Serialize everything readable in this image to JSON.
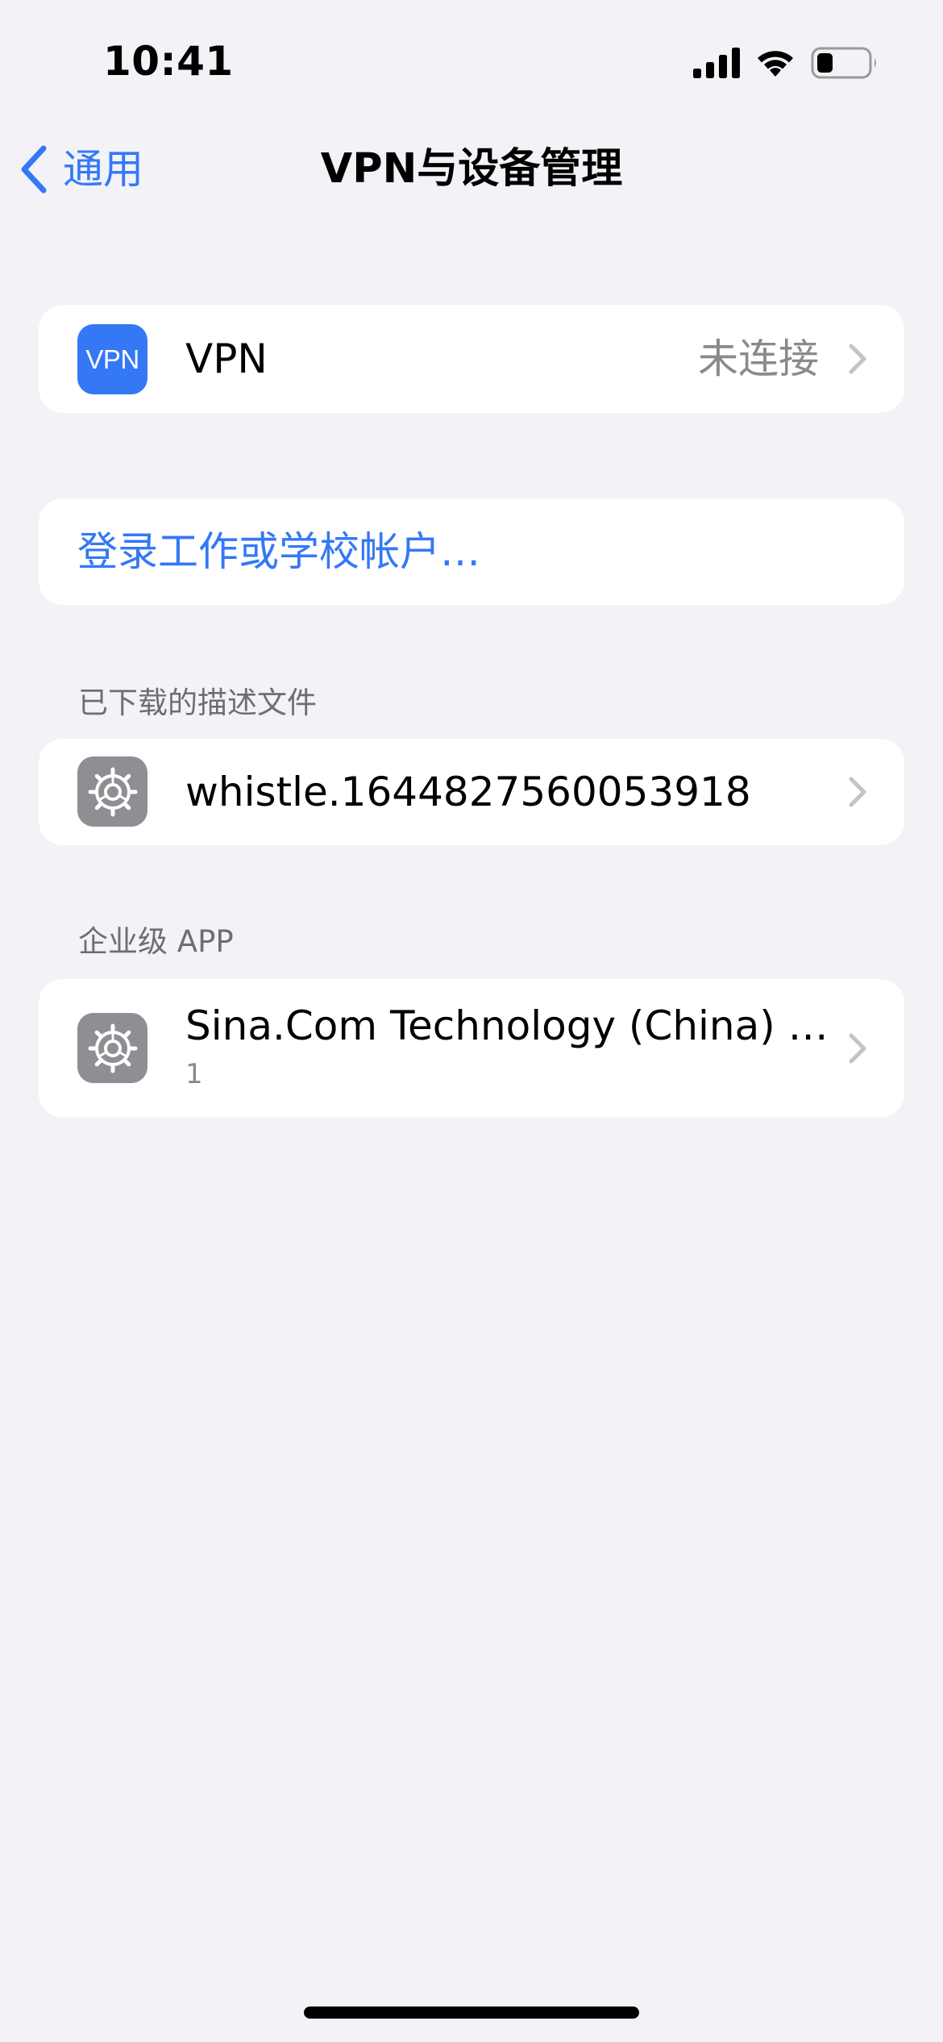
{
  "status_bar": {
    "time": "10:41"
  },
  "nav": {
    "back_label": "通用",
    "title": "VPN与设备管理"
  },
  "vpn_row": {
    "icon_text": "VPN",
    "label": "VPN",
    "value": "未连接"
  },
  "account_row": {
    "label": "登录工作或学校帐户…"
  },
  "profiles_section": {
    "header": "已下载的描述文件",
    "items": [
      {
        "label": "whistle.1644827560053918"
      }
    ]
  },
  "enterprise_section": {
    "header": "企业级 APP",
    "items": [
      {
        "label": "Sina.Com Technology (China) Co...",
        "sublabel": "1"
      }
    ]
  },
  "colors": {
    "background": "#F2F2F7",
    "card": "#FFFFFF",
    "accent": "#3478F6",
    "secondary_text": "#8A8A8E",
    "gear_tile": "#8E8E93",
    "chevron": "#C4C4C7"
  },
  "icons": [
    "signal-icon",
    "wifi-icon",
    "battery-icon",
    "chevron-left-icon",
    "gear-icon",
    "chevron-right-icon"
  ]
}
